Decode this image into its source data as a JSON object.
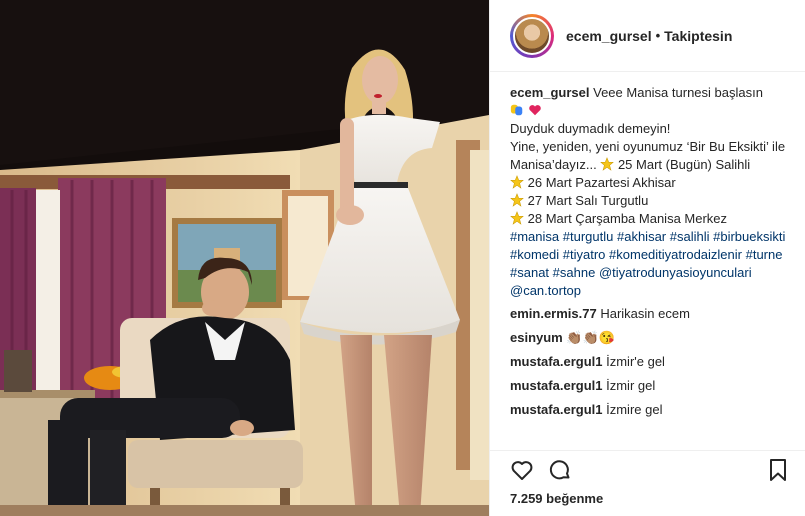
{
  "post": {
    "username": "ecem_gursel",
    "separator": "•",
    "follow_status": "Takiptesin"
  },
  "caption": {
    "username": "ecem_gursel",
    "line1": "Veee Manisa turnesi başlasın",
    "line2": "Duyduk duymadık demeyin!",
    "line3": "Yine, yeniden, yeni oyunumuz ‘Bir Bu Eksikti’ ile Manisa’dayız...",
    "line3_tail": "25 Mart (Bugün) Salihli",
    "line4": "26 Mart Pazartesi Akhisar",
    "line5": "27 Mart Salı Turgutlu",
    "line6": "28 Mart Çarşamba Manisa Merkez",
    "hashtags": [
      "#manisa",
      "#turgutlu",
      "#akhisar",
      "#salihli",
      "#birbueksikti",
      "#komedi",
      "#tiyatro",
      "#komeditiyatrodaizlenir",
      "#turne",
      "#sanat",
      "#sahne",
      "@tiyatrodunyasioyunculari",
      "@can.tortop"
    ]
  },
  "comments": [
    {
      "user": "emin.ermis.77",
      "text": "Harikasin ecem"
    },
    {
      "user": "esinyum",
      "text": "👏🏽👏🏽😘"
    },
    {
      "user": "mustafa.ergul1",
      "text": "İzmir'e gel"
    },
    {
      "user": "mustafa.ergul1",
      "text": "İzmir gel"
    },
    {
      "user": "mustafa.ergul1",
      "text": "İzmire gel"
    }
  ],
  "footer": {
    "likes": "7.259 beğenme"
  },
  "icons": [
    "heart-icon",
    "comment-icon",
    "bookmark-icon",
    "star-icon",
    "theater-masks-icon",
    "red-heart-icon"
  ],
  "colors": {
    "link": "#003569",
    "text": "#262626",
    "border": "#efefef",
    "star": "#f5c518"
  }
}
